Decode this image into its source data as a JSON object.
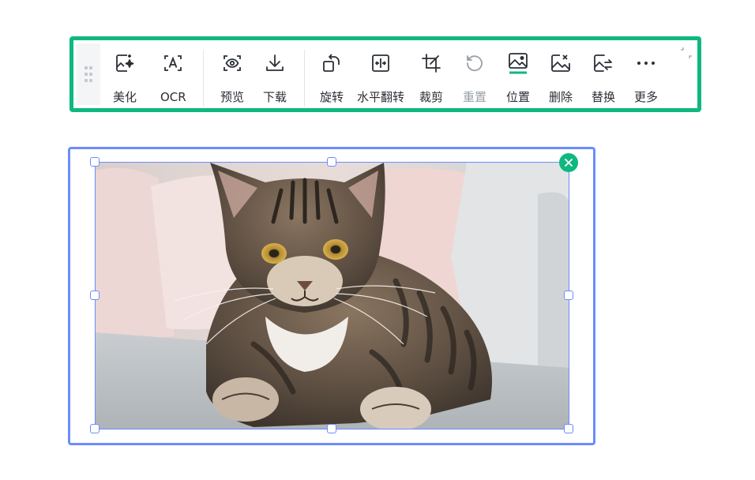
{
  "toolbar": {
    "tools": [
      {
        "id": "beautify",
        "label": "美化",
        "icon": "sparkle-image-icon",
        "enabled": true
      },
      {
        "id": "ocr",
        "label": "OCR",
        "icon": "ocr-icon",
        "enabled": true
      },
      {
        "id": "preview",
        "label": "预览",
        "icon": "eye-icon",
        "enabled": true
      },
      {
        "id": "download",
        "label": "下载",
        "icon": "download-icon",
        "enabled": true
      },
      {
        "id": "rotate",
        "label": "旋转",
        "icon": "rotate-icon",
        "enabled": true
      },
      {
        "id": "flip",
        "label": "水平翻转",
        "icon": "flip-horizontal-icon",
        "enabled": true
      },
      {
        "id": "crop",
        "label": "裁剪",
        "icon": "crop-icon",
        "enabled": true
      },
      {
        "id": "reset",
        "label": "重置",
        "icon": "reset-icon",
        "enabled": false
      },
      {
        "id": "position",
        "label": "位置",
        "icon": "position-image-icon",
        "enabled": true
      },
      {
        "id": "delete",
        "label": "删除",
        "icon": "delete-image-icon",
        "enabled": true
      },
      {
        "id": "replace",
        "label": "替换",
        "icon": "replace-image-icon",
        "enabled": true
      },
      {
        "id": "more",
        "label": "更多",
        "icon": "more-icon",
        "enabled": true
      }
    ]
  },
  "image": {
    "subject": "tabby cat",
    "selected": true
  },
  "colors": {
    "accent": "#0fb87f",
    "selection": "#6b8cff",
    "text": "#2b2f36",
    "disabled": "#9aa0a8"
  }
}
